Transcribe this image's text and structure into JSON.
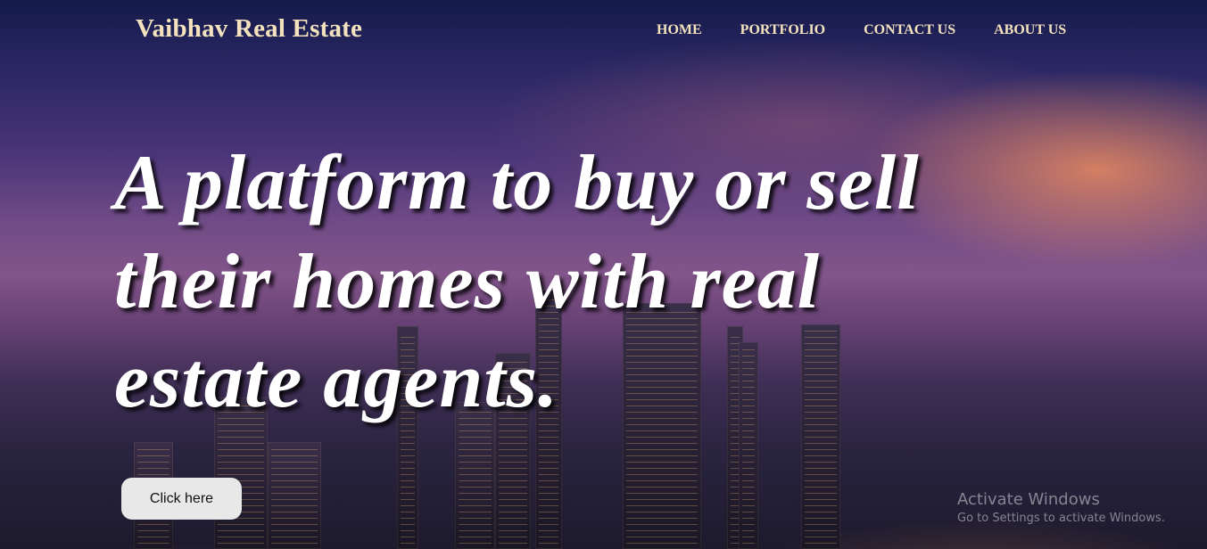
{
  "brand": {
    "name": "Vaibhav Real Estate"
  },
  "nav": {
    "items": [
      {
        "label": "HOME"
      },
      {
        "label": "PORTFOLIO"
      },
      {
        "label": "CONTACT US"
      },
      {
        "label": "ABOUT US"
      }
    ]
  },
  "hero": {
    "headline": "A platform to buy or sell their homes with real estate agents.",
    "cta_label": "Click here"
  },
  "watermark": {
    "title": "Activate Windows",
    "subtitle": "Go to Settings to activate Windows."
  },
  "colors": {
    "nav_text": "#f3e2bd",
    "headline": "#ffffff",
    "button_bg": "#e8e8e8"
  }
}
